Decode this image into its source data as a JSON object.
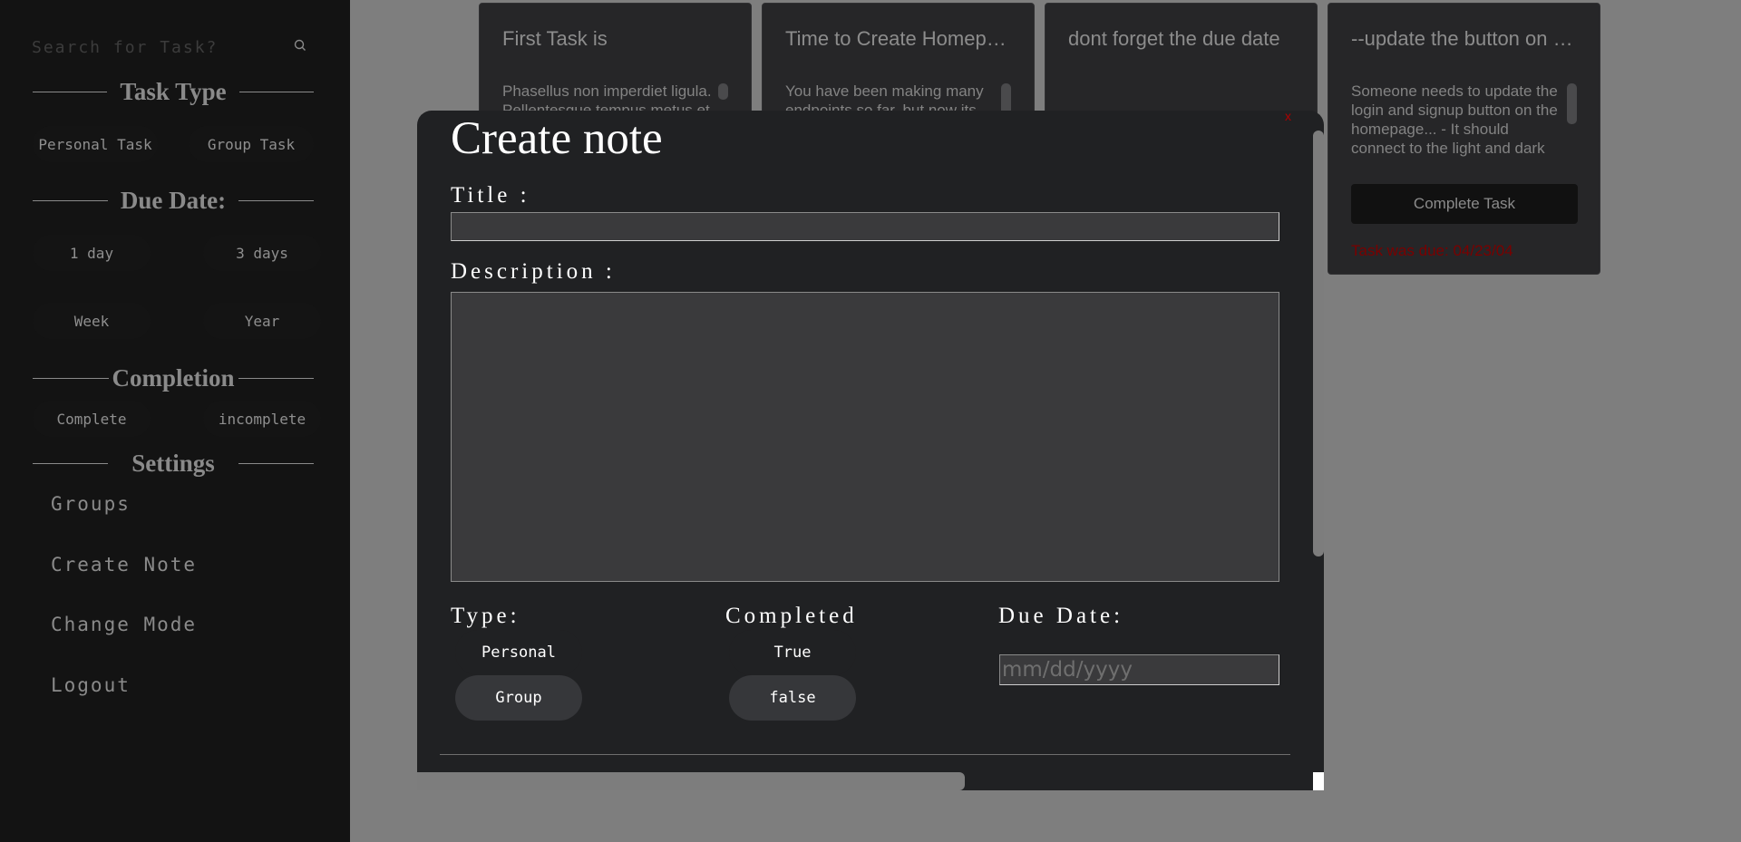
{
  "sidebar": {
    "search": {
      "placeholder": "Search for Task?",
      "icon": "search-icon"
    },
    "sections": {
      "task_type": "Task Type",
      "due_date": "Due Date:",
      "completion": "Completion",
      "settings": "Settings"
    },
    "task_type_options": [
      "Personal Task",
      "Group Task"
    ],
    "due_date_options": [
      "1 day",
      "3 days",
      "Week",
      "Year"
    ],
    "completion_options": [
      "Complete",
      "incomplete"
    ],
    "settings_items": [
      "Groups",
      "Create Note",
      "Change Mode",
      "Logout"
    ]
  },
  "cards": [
    {
      "title": "First Task is",
      "description": "Phasellus non imperdiet ligula. Pellentesque tempus metus et"
    },
    {
      "title": "Time to Create Homepage",
      "description": "You have been making many endpoints so far, but now its"
    },
    {
      "title": "dont forget the due date",
      "description": ""
    },
    {
      "title": "--update the button on the homepage",
      "description": "Someone needs to update the login and signup button on the homepage... - It should connect to the light and dark mode - The icon should fit",
      "button": "Complete Task",
      "due": "Task was due: 04/23/04"
    }
  ],
  "modal": {
    "close": "x",
    "title": "Create note",
    "title_label": "Title :",
    "description_label": "Description :",
    "type_label": "Type:",
    "type_options": [
      "Personal",
      "Group"
    ],
    "completed_label": "Completed",
    "completed_options": [
      "True",
      "false"
    ],
    "due_label": "Due Date:",
    "due_placeholder": "mm/dd/yyyy"
  },
  "colors": {
    "backdrop": "#7e7e7e",
    "sidebar": "#131313",
    "card": "#262628",
    "modal": "#202123",
    "overdue": "#7a0000"
  }
}
